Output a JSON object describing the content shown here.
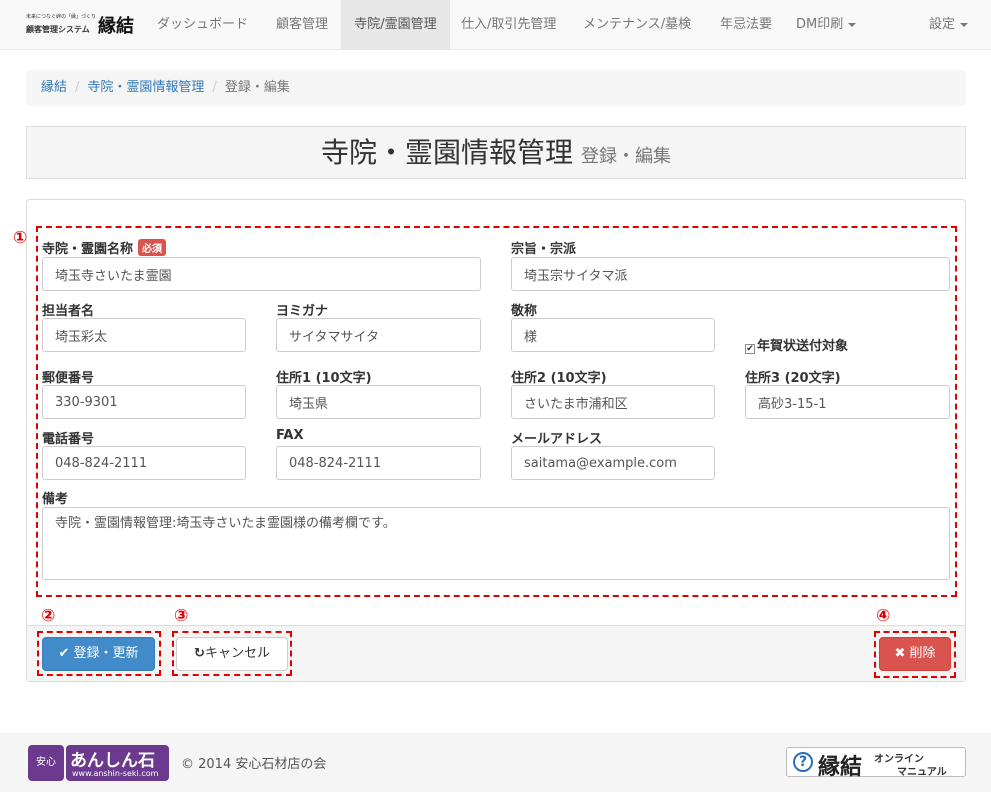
{
  "navbar": {
    "brand_tagline": "未来につなぐ絆の「縁」づくり",
    "brand_system": "顧客管理システム",
    "brand_logo": "縁結",
    "items": [
      "ダッシュボード",
      "顧客管理",
      "寺院/霊園管理",
      "仕入/取引先管理",
      "メンテナンス/墓検",
      "年忌法要",
      "DM印刷"
    ],
    "settings": "設定"
  },
  "breadcrumb": {
    "home": "縁結",
    "section": "寺院・霊園情報管理",
    "current": "登録・編集"
  },
  "header": {
    "title": "寺院・霊園情報管理",
    "subtitle": "登録・編集"
  },
  "markers": [
    "①",
    "②",
    "③",
    "④"
  ],
  "form": {
    "temple_name": {
      "label": "寺院・霊園名称",
      "required": "必須",
      "value": "埼玉寺さいたま霊園"
    },
    "sect": {
      "label": "宗旨・宗派",
      "value": "埼玉宗サイタマ派"
    },
    "person": {
      "label": "担当者名",
      "value": "埼玉彩太"
    },
    "kana": {
      "label": "ヨミガナ",
      "value": "サイタマサイタ"
    },
    "honorific": {
      "label": "敬称",
      "value": "様"
    },
    "newyear": {
      "label": "年賀状送付対象",
      "checked": true
    },
    "zip": {
      "label": "郵便番号",
      "value": "330-9301"
    },
    "addr1": {
      "label": "住所1 (10文字)",
      "value": "埼玉県"
    },
    "addr2": {
      "label": "住所2 (10文字)",
      "value": "さいたま市浦和区"
    },
    "addr3": {
      "label": "住所3 (20文字)",
      "value": "高砂3-15-1"
    },
    "phone": {
      "label": "電話番号",
      "value": "048-824-2111"
    },
    "fax": {
      "label": "FAX",
      "value": "048-824-2111"
    },
    "email": {
      "label": "メールアドレス",
      "value": "saitama@example.com"
    },
    "notes": {
      "label": "備考",
      "value": "寺院・霊園情報管理:埼玉寺さいたま霊園様の備考欄です。"
    }
  },
  "buttons": {
    "save": "登録・更新",
    "cancel": "キャンセル",
    "delete": "削除"
  },
  "footer": {
    "anshin_seal": "安心",
    "anshin_name": "あんしん石",
    "anshin_url": "www.anshin-seki.com",
    "copyright": "© 2014 安心石材店の会",
    "manual_logo": "縁結",
    "manual_line1": "オンライン",
    "manual_line2": "マニュアル"
  }
}
